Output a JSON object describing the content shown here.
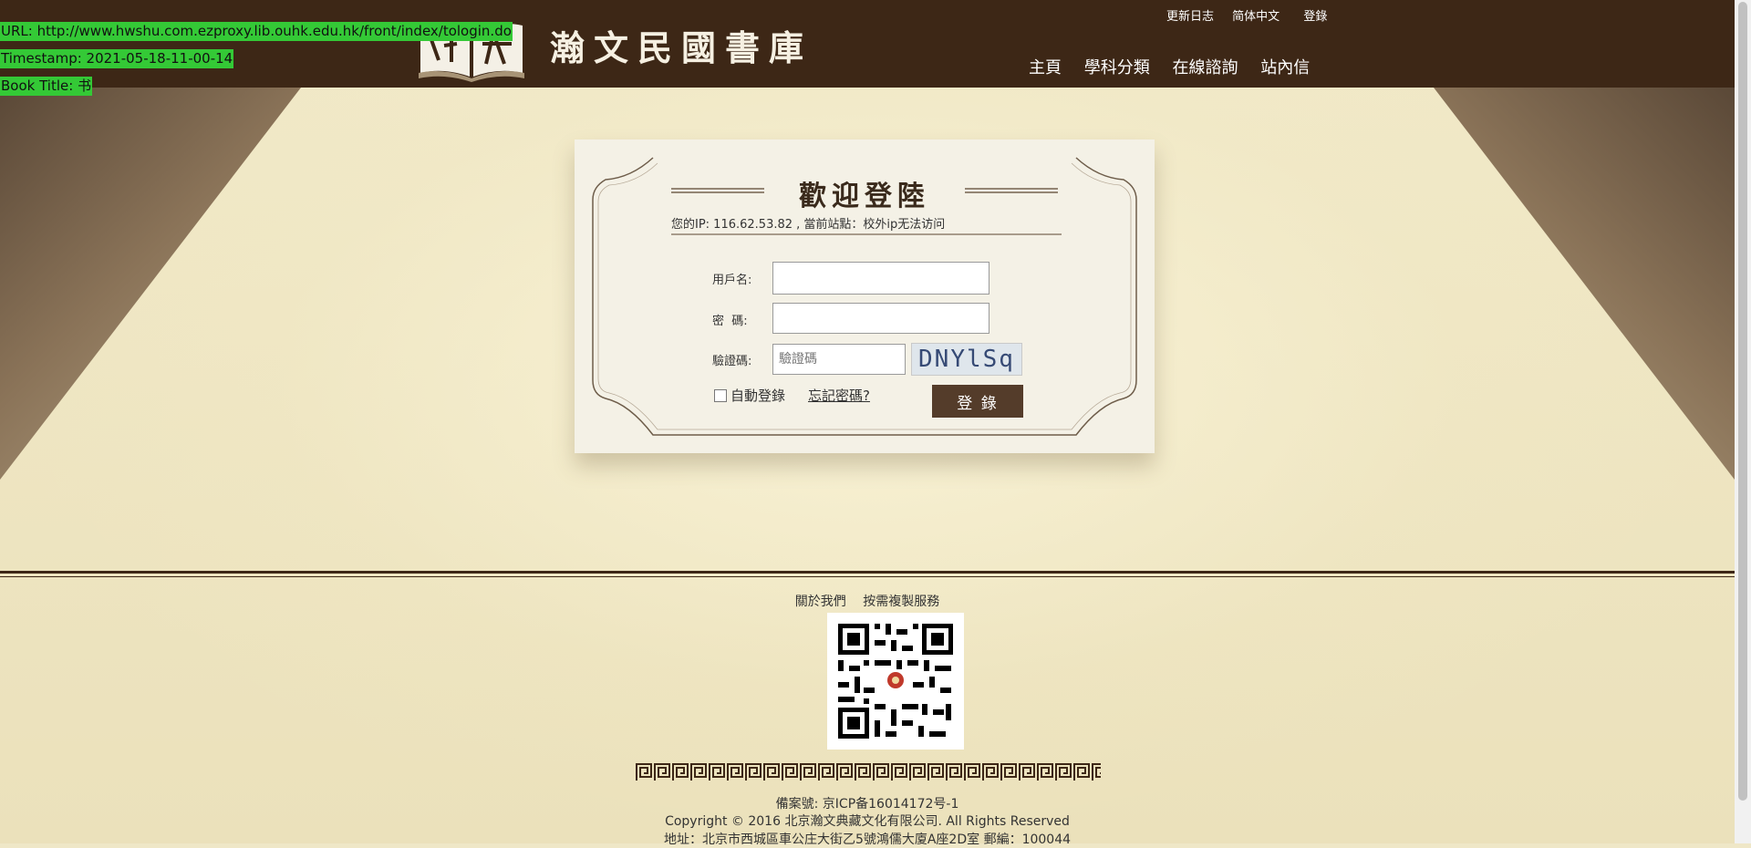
{
  "overlay": {
    "url": "URL: http://www.hwshu.com.ezproxy.lib.ouhk.edu.hk/front/index/tologin.do",
    "timestamp": "Timestamp: 2021-05-18-11-00-14",
    "book_title": "Book Title: 书"
  },
  "header": {
    "site_title": "瀚文民國書庫",
    "top_links": [
      "更新日志",
      "简体中文",
      "登錄"
    ],
    "nav": [
      "主頁",
      "學科分類",
      "在線諮詢",
      "站內信"
    ]
  },
  "login": {
    "title": "歡迎登陸",
    "ip_text": "您的IP: 116.62.53.82 , 當前站點：校外ip无法访问",
    "username_label": "用戶名:",
    "password_label": "密  碼:",
    "captcha_label": "驗證碼:",
    "captcha_placeholder": "驗證碼",
    "captcha_text": "DNYlSq",
    "auto_login": "自動登錄",
    "forgot": "忘記密碼?",
    "button": "登  錄"
  },
  "footer": {
    "links": [
      "關於我們",
      "按需複製服務"
    ],
    "icp": "備案號: 京ICP备16014172号-1",
    "copyright": "Copyright © 2016 北京瀚文典藏文化有限公司. All Rights Reserved",
    "address": "地址：北京市西城區車公庄大街乙5號鴻儒大廈A座2D室 郵編：100044"
  },
  "colors": {
    "header_bg": "#3d2716",
    "button_bg": "#543c2a",
    "overlay_bg": "#34c936",
    "page_bg": "#efe7c7"
  }
}
